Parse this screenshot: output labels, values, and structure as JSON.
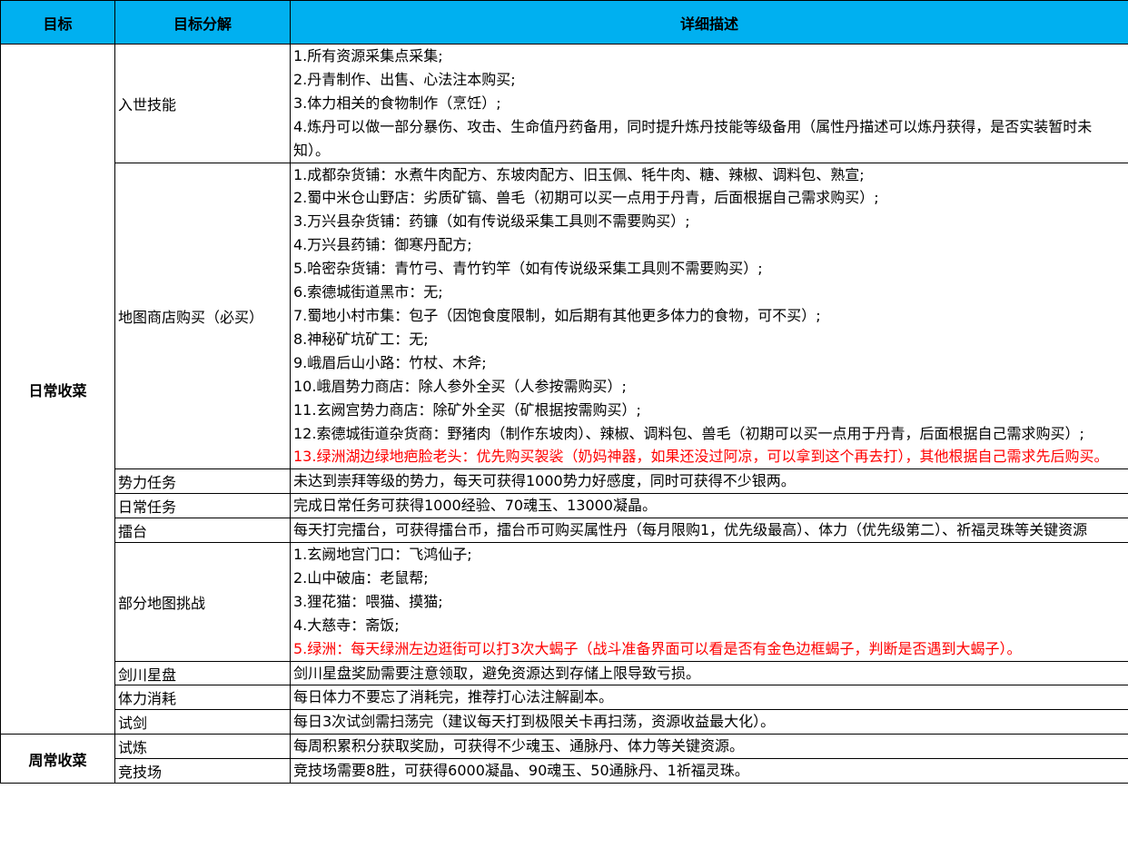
{
  "headers": [
    "目标",
    "目标分解",
    "详细描述"
  ],
  "groups": [
    {
      "goal": "日常收菜",
      "rows": [
        {
          "sub": "入世技能",
          "lines": [
            {
              "text": "1.所有资源采集点采集;"
            },
            {
              "text": "2.丹青制作、出售、心法注本购买;"
            },
            {
              "text": "3.体力相关的食物制作（烹饪）;"
            },
            {
              "text": "4.炼丹可以做一部分暴伤、攻击、生命值丹药备用，同时提升炼丹技能等级备用（属性丹描述可以炼丹获得，是否实装暂时未知）。"
            }
          ]
        },
        {
          "sub": "地图商店购买（必买）",
          "lines": [
            {
              "text": "1.成都杂货铺：水煮牛肉配方、东坡肉配方、旧玉佩、牦牛肉、糖、辣椒、调料包、熟宣;"
            },
            {
              "text": "2.蜀中米仓山野店：劣质矿镐、兽毛（初期可以买一点用于丹青，后面根据自己需求购买）;"
            },
            {
              "text": "3.万兴县杂货铺：药镰（如有传说级采集工具则不需要购买）;"
            },
            {
              "text": "4.万兴县药铺：御寒丹配方;"
            },
            {
              "text": "5.哈密杂货铺：青竹弓、青竹钓竿（如有传说级采集工具则不需要购买）;"
            },
            {
              "text": "6.索德城街道黑市：无;"
            },
            {
              "text": "7.蜀地小村市集：包子（因饱食度限制，如后期有其他更多体力的食物，可不买）;"
            },
            {
              "text": "8.神秘矿坑矿工：无;"
            },
            {
              "text": "9.峨眉后山小路：竹杖、木斧;"
            },
            {
              "text": "10.峨眉势力商店：除人参外全买（人参按需购买）;"
            },
            {
              "text": "11.玄阙宫势力商店：除矿外全买（矿根据按需购买）;"
            },
            {
              "text": "12.索德城街道杂货商：野猪肉（制作东坡肉）、辣椒、调料包、兽毛（初期可以买一点用于丹青，后面根据自己需求购买）;"
            },
            {
              "text": "13.绿洲湖边绿地疤脸老头：优先购买袈裟（奶妈神器，如果还没过阿凉，可以拿到这个再去打），其他根据自己需求先后购买。",
              "red": true
            }
          ]
        },
        {
          "sub": "势力任务",
          "lines": [
            {
              "text": "未达到崇拜等级的势力，每天可获得1000势力好感度，同时可获得不少银两。"
            }
          ]
        },
        {
          "sub": "日常任务",
          "lines": [
            {
              "text": "完成日常任务可获得1000经验、70魂玉、13000凝晶。"
            }
          ]
        },
        {
          "sub": "擂台",
          "lines": [
            {
              "text": "每天打完擂台，可获得擂台币，擂台币可购买属性丹（每月限购1，优先级最高）、体力（优先级第二）、祈福灵珠等关键资源"
            }
          ]
        },
        {
          "sub": "部分地图挑战",
          "lines": [
            {
              "text": "1.玄阙地宫门口：飞鸿仙子;"
            },
            {
              "text": "2.山中破庙：老鼠帮;"
            },
            {
              "text": "3.狸花猫：喂猫、摸猫;"
            },
            {
              "text": "4.大慈寺：斋饭;"
            },
            {
              "text": "5.绿洲：每天绿洲左边逛街可以打3次大蝎子（战斗准备界面可以看是否有金色边框蝎子，判断是否遇到大蝎子）。",
              "red": true
            }
          ]
        },
        {
          "sub": "剑川星盘",
          "lines": [
            {
              "text": "剑川星盘奖励需要注意领取，避免资源达到存储上限导致亏损。"
            }
          ]
        },
        {
          "sub": "体力消耗",
          "lines": [
            {
              "text": "每日体力不要忘了消耗完，推荐打心法注解副本。"
            }
          ]
        },
        {
          "sub": "试剑",
          "lines": [
            {
              "text": "每日3次试剑需扫荡完（建议每天打到极限关卡再扫荡，资源收益最大化）。"
            }
          ]
        }
      ]
    },
    {
      "goal": "周常收菜",
      "rows": [
        {
          "sub": "试炼",
          "lines": [
            {
              "text": "每周积累积分获取奖励，可获得不少魂玉、通脉丹、体力等关键资源。"
            }
          ]
        },
        {
          "sub": "竞技场",
          "lines": [
            {
              "text": "竞技场需要8胜，可获得6000凝晶、90魂玉、50通脉丹、1祈福灵珠。"
            }
          ]
        }
      ]
    }
  ]
}
